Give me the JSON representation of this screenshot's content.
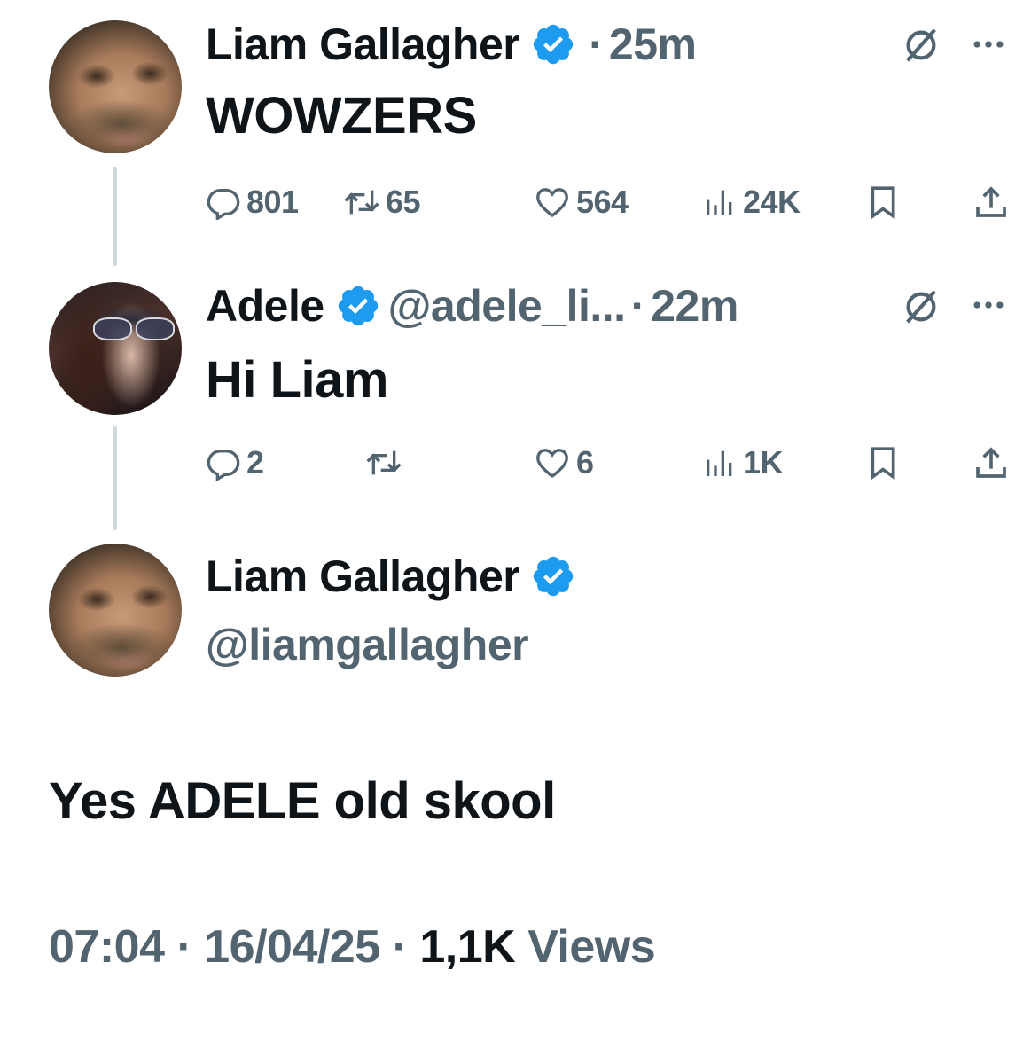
{
  "tweets": [
    {
      "name": "Liam Gallagher",
      "verified": true,
      "time": "25m",
      "text": "WOWZERS",
      "stats": {
        "replies": "801",
        "reposts": "65",
        "likes": "564",
        "views": "24K"
      }
    },
    {
      "name": "Adele",
      "verified": true,
      "handle": "@adele_li...",
      "time": "22m",
      "text": "Hi Liam",
      "stats": {
        "replies": "2",
        "reposts": "",
        "likes": "6",
        "views": "1K"
      }
    }
  ],
  "main_tweet": {
    "name": "Liam Gallagher",
    "verified": true,
    "handle": "@liamgallagher",
    "text": "Yes ADELE old skool",
    "time": "07:04",
    "date": "16/04/25",
    "views_count": "1,1K",
    "views_label": "Views"
  },
  "separator": "·",
  "icons": [
    "reply-icon",
    "repost-icon",
    "like-icon",
    "views-icon",
    "bookmark-icon",
    "share-icon",
    "grok-icon",
    "more-icon",
    "verified-badge-icon"
  ],
  "colors": {
    "verified": "#1d9bf0",
    "secondary_text": "#536471",
    "primary_text": "#0f1419",
    "thread_line": "#cfd9de"
  }
}
